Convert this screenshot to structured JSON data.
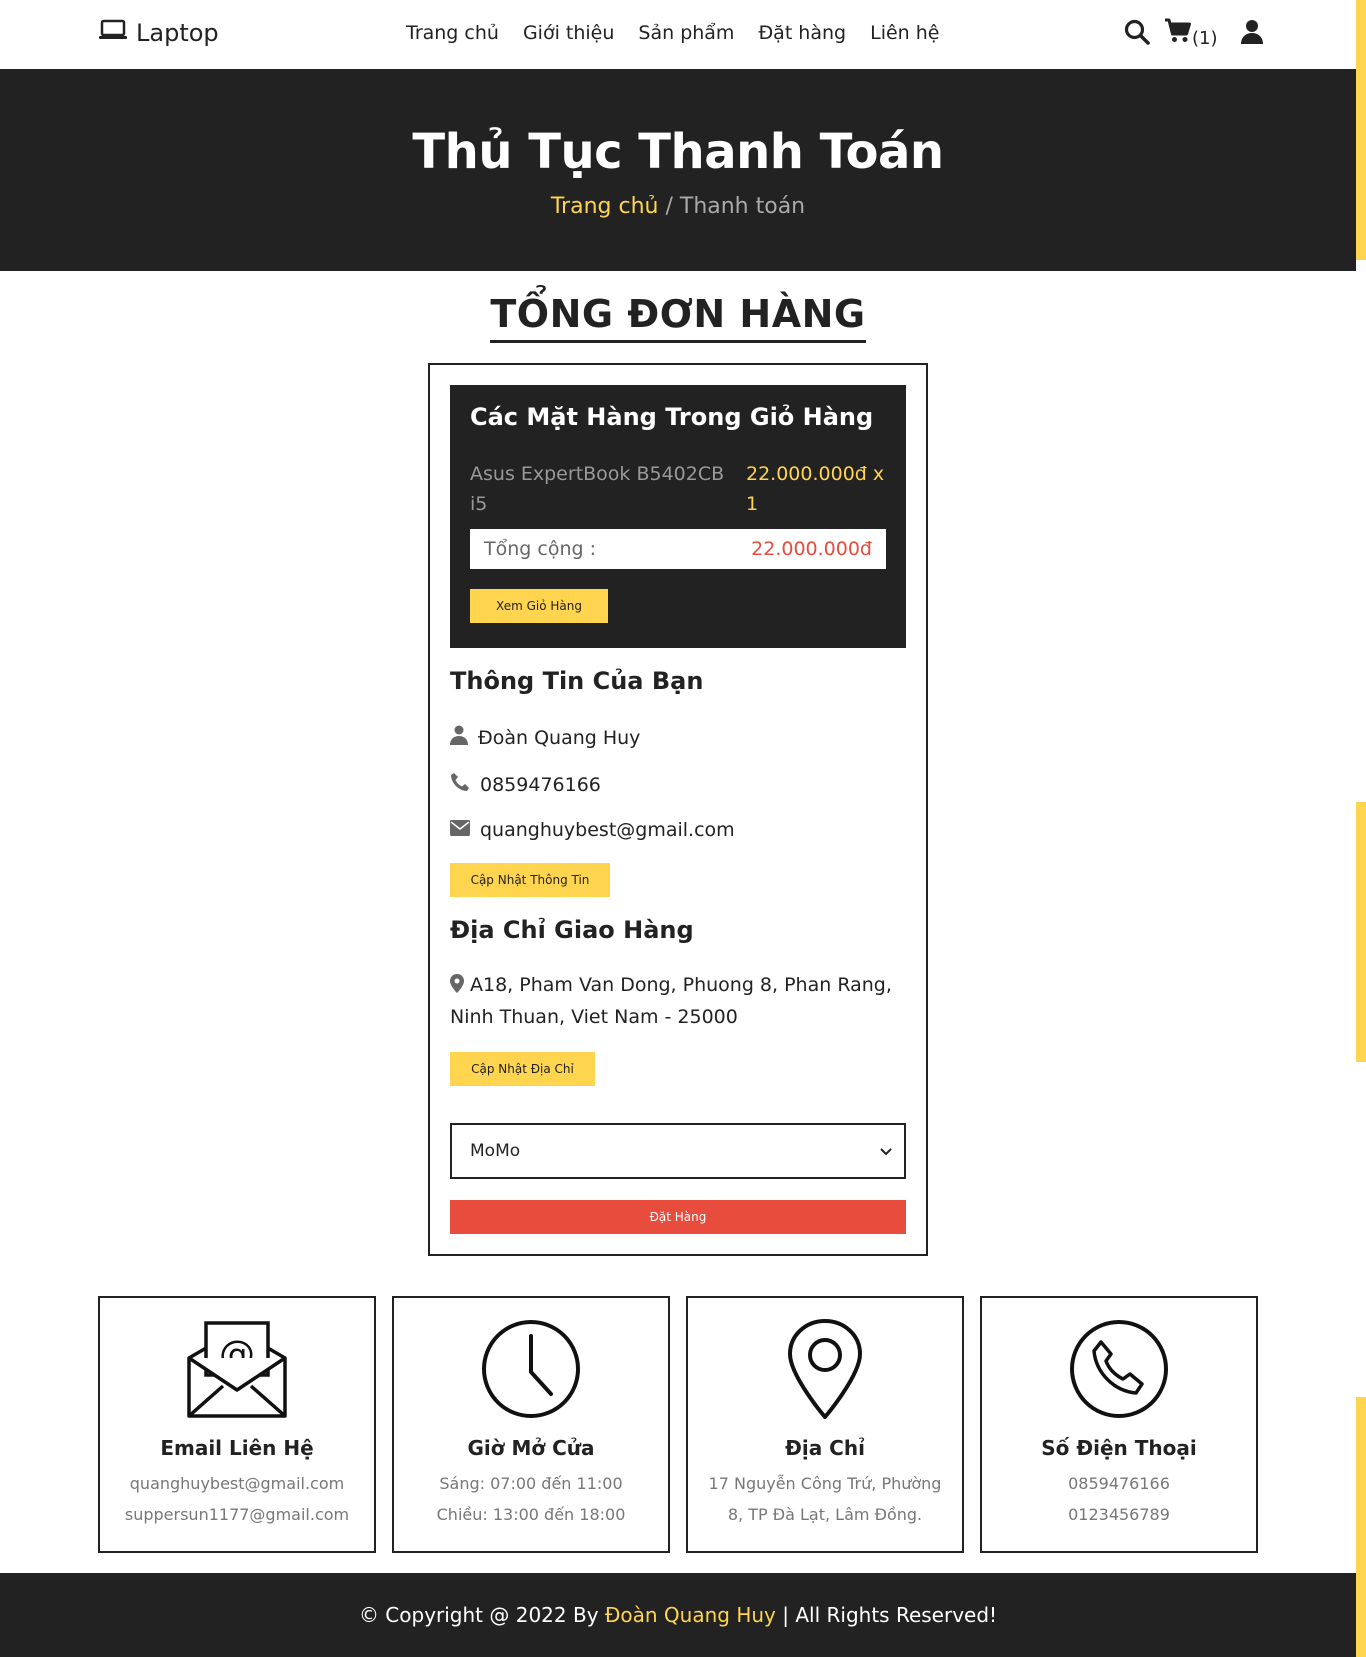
{
  "header": {
    "logo_text": "Laptop",
    "nav": [
      "Trang chủ",
      "Giới thiệu",
      "Sản phẩm",
      "Đặt hàng",
      "Liên hệ"
    ],
    "cart_count": "(1)"
  },
  "banner": {
    "title": "Thủ Tục Thanh Toán",
    "crumb_home": "Trang chủ",
    "crumb_current": "/ Thanh toán"
  },
  "section_title": "TỔNG ĐƠN HÀNG",
  "cart": {
    "heading": "Các Mặt Hàng Trong Giỏ Hàng",
    "item_name": "Asus ExpertBook B5402CB i5",
    "item_price": "22.000.000đ x 1",
    "total_label": "Tổng cộng :",
    "total_value": "22.000.000đ",
    "view_cart_button": "Xem Giỏ Hàng"
  },
  "user_info": {
    "heading": "Thông Tin Của Bạn",
    "name": "Đoàn Quang Huy",
    "phone": "0859476166",
    "email": "quanghuybest@gmail.com",
    "update_button": "Cập Nhật Thông Tin"
  },
  "shipping": {
    "heading": "Địa Chỉ Giao Hàng",
    "address": "A18, Pham Van Dong, Phuong 8, Phan Rang, Ninh Thuan, Viet Nam - 25000",
    "update_button": "Cập Nhật Địa Chỉ"
  },
  "payment": {
    "selected": "MoMo",
    "order_button": "Đặt Hàng"
  },
  "contact_cards": [
    {
      "title": "Email Liên Hệ",
      "line1": "quanghuybest@gmail.com",
      "line2": "suppersun1177@gmail.com",
      "icon": "envelope-at-icon"
    },
    {
      "title": "Giờ Mở Cửa",
      "line1": "Sáng: 07:00 đến 11:00",
      "line2": "Chiều: 13:00 đến 18:00",
      "icon": "clock-icon"
    },
    {
      "title": "Địa Chỉ",
      "line1": "17 Nguyễn Công Trứ, Phường",
      "line2": "8, TP Đà Lạt, Lâm Đồng.",
      "icon": "map-pin-icon"
    },
    {
      "title": "Số Điện Thoại",
      "line1": "0859476166",
      "line2": "0123456789",
      "icon": "phone-icon"
    }
  ],
  "footer": {
    "prefix": "© Copyright @ 2022 By",
    "author": "Đoàn Quang Huy",
    "suffix": "| All Rights Reserved!"
  },
  "colors": {
    "accent": "#ffd54f",
    "dark": "#222222",
    "danger": "#e74c3c"
  }
}
